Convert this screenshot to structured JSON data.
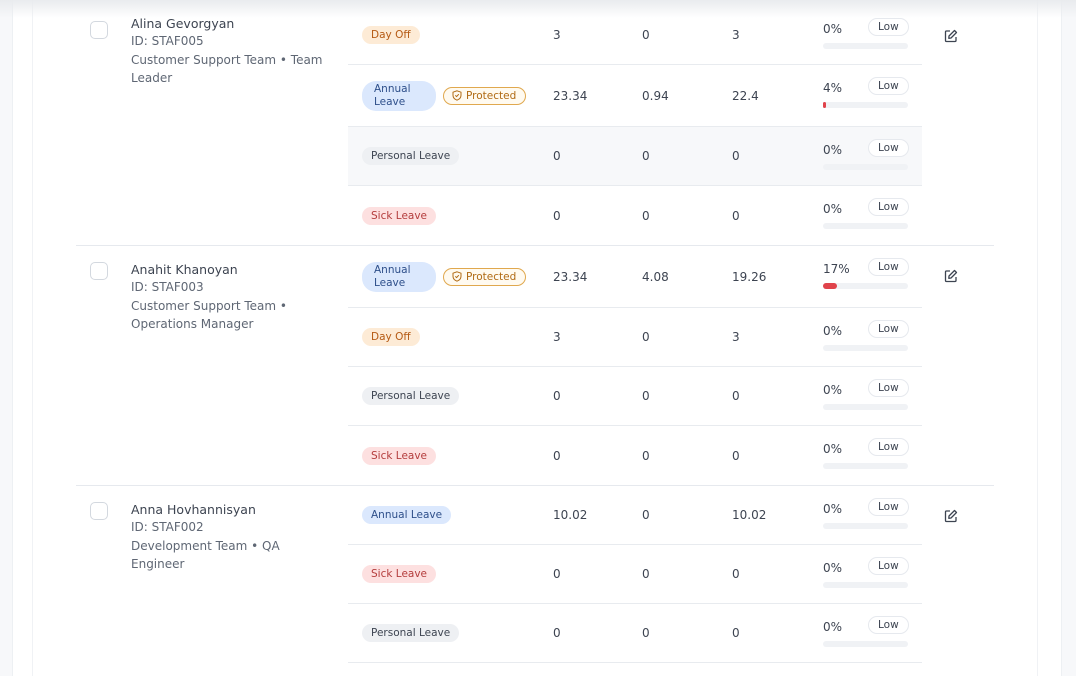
{
  "colors": {
    "danger_bar": "#e0434b",
    "protected_border": "#e0a84e"
  },
  "staff": [
    {
      "name": "Alina Gevorgyan",
      "id": "ID: STAF005",
      "team": "Customer Support Team • Team Leader",
      "leaves": [
        {
          "type": "Day Off",
          "style": "day",
          "protected": false,
          "total": "3",
          "used": "0",
          "remaining": "3",
          "usage": "0%",
          "usage_fraction": 0,
          "level": "Low"
        },
        {
          "type": "Annual Leave",
          "style": "annual2",
          "protected": true,
          "total": "23.34",
          "used": "0.94",
          "remaining": "22.4",
          "usage": "4%",
          "usage_fraction": 0.04,
          "level": "Low"
        },
        {
          "type": "Personal Leave",
          "style": "personal",
          "protected": false,
          "total": "0",
          "used": "0",
          "remaining": "0",
          "usage": "0%",
          "usage_fraction": 0,
          "level": "Low"
        },
        {
          "type": "Sick Leave",
          "style": "sick",
          "protected": false,
          "total": "0",
          "used": "0",
          "remaining": "0",
          "usage": "0%",
          "usage_fraction": 0,
          "level": "Low"
        }
      ]
    },
    {
      "name": "Anahit Khanoyan",
      "id": "ID: STAF003",
      "team": "Customer Support Team • Operations Manager",
      "leaves": [
        {
          "type": "Annual Leave",
          "style": "annual2",
          "protected": true,
          "total": "23.34",
          "used": "4.08",
          "remaining": "19.26",
          "usage": "17%",
          "usage_fraction": 0.17,
          "level": "Low"
        },
        {
          "type": "Day Off",
          "style": "day",
          "protected": false,
          "total": "3",
          "used": "0",
          "remaining": "3",
          "usage": "0%",
          "usage_fraction": 0,
          "level": "Low"
        },
        {
          "type": "Personal Leave",
          "style": "personal",
          "protected": false,
          "total": "0",
          "used": "0",
          "remaining": "0",
          "usage": "0%",
          "usage_fraction": 0,
          "level": "Low"
        },
        {
          "type": "Sick Leave",
          "style": "sick",
          "protected": false,
          "total": "0",
          "used": "0",
          "remaining": "0",
          "usage": "0%",
          "usage_fraction": 0,
          "level": "Low"
        }
      ]
    },
    {
      "name": "Anna Hovhannisyan",
      "id": "ID: STAF002",
      "team": "Development Team • QA Engineer",
      "leaves": [
        {
          "type": "Annual Leave",
          "style": "annual",
          "protected": false,
          "total": "10.02",
          "used": "0",
          "remaining": "10.02",
          "usage": "0%",
          "usage_fraction": 0,
          "level": "Low"
        },
        {
          "type": "Sick Leave",
          "style": "sick",
          "protected": false,
          "total": "0",
          "used": "0",
          "remaining": "0",
          "usage": "0%",
          "usage_fraction": 0,
          "level": "Low"
        },
        {
          "type": "Personal Leave",
          "style": "personal",
          "protected": false,
          "total": "0",
          "used": "0",
          "remaining": "0",
          "usage": "0%",
          "usage_fraction": 0,
          "level": "Low"
        }
      ]
    }
  ],
  "protected_label": "Protected"
}
